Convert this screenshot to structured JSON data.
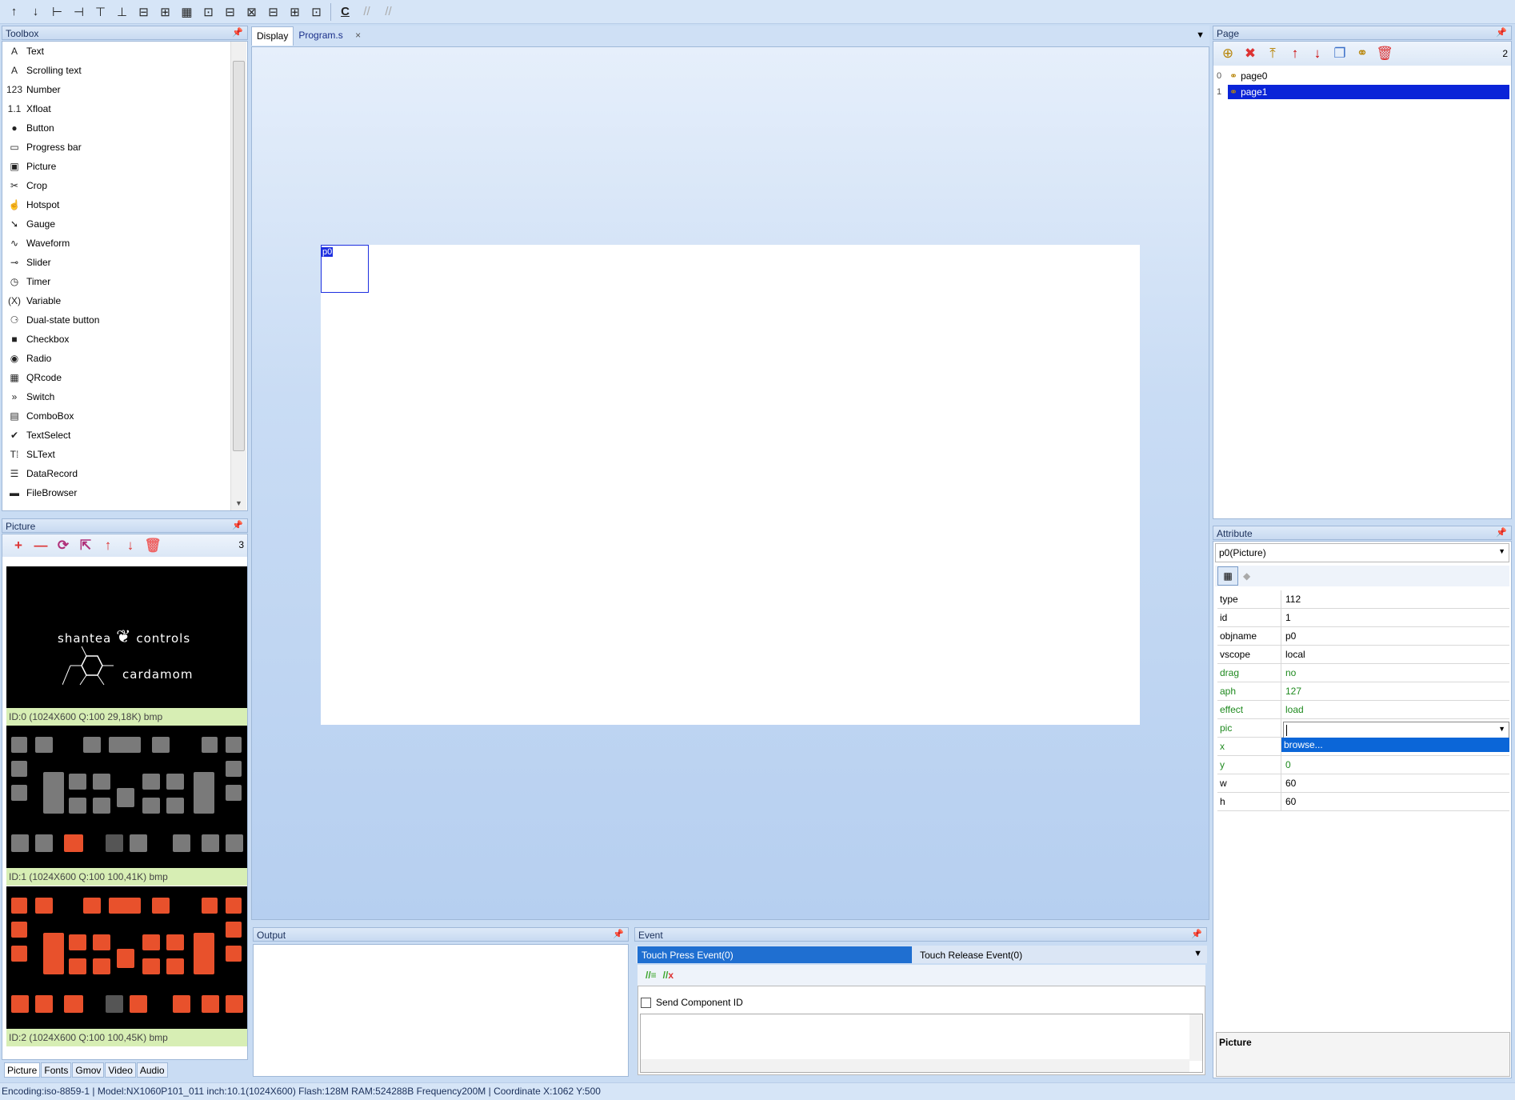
{
  "toolbar": {
    "buttons": [
      "move-up",
      "move-down",
      "align-left",
      "align-right",
      "align-top",
      "align-bottom",
      "center-horizontal",
      "center-vertical",
      "grid",
      "same-width",
      "same-height",
      "distribute-horizontal",
      "equal-size",
      "distribute-vertical",
      "distribute-even"
    ],
    "glyphs": [
      "↑",
      "↓",
      "⊢",
      "⊣",
      "⊤",
      "⊥",
      "⊟",
      "⊞",
      "▦",
      "⊡",
      "⊟",
      "⊠",
      "⊟",
      "⊞",
      "⊡"
    ],
    "comment_glyph": "C",
    "uncomment_glyph": "//"
  },
  "toolbox": {
    "title": "Toolbox",
    "items": [
      {
        "icon": "A",
        "label": "Text"
      },
      {
        "icon": "A",
        "label": "Scrolling text"
      },
      {
        "icon": "123",
        "label": "Number"
      },
      {
        "icon": "1.1",
        "label": "Xfloat"
      },
      {
        "icon": "●",
        "label": "Button"
      },
      {
        "icon": "▭",
        "label": "Progress bar"
      },
      {
        "icon": "▣",
        "label": "Picture"
      },
      {
        "icon": "✂",
        "label": "Crop"
      },
      {
        "icon": "☝",
        "label": "Hotspot"
      },
      {
        "icon": "➘",
        "label": "Gauge"
      },
      {
        "icon": "∿",
        "label": "Waveform"
      },
      {
        "icon": "⊸",
        "label": "Slider"
      },
      {
        "icon": "◷",
        "label": "Timer"
      },
      {
        "icon": "(X)",
        "label": "Variable"
      },
      {
        "icon": "⚆",
        "label": "Dual-state button"
      },
      {
        "icon": "■",
        "label": "Checkbox"
      },
      {
        "icon": "◉",
        "label": "Radio"
      },
      {
        "icon": "▦",
        "label": "QRcode"
      },
      {
        "icon": "»",
        "label": "Switch"
      },
      {
        "icon": "▤",
        "label": "ComboBox"
      },
      {
        "icon": "✔",
        "label": "TextSelect"
      },
      {
        "icon": "T⁞",
        "label": "SLText"
      },
      {
        "icon": "☰",
        "label": "DataRecord"
      },
      {
        "icon": "▬",
        "label": "FileBrowser"
      }
    ]
  },
  "picture_panel": {
    "title": "Picture",
    "count": "3",
    "tool_glyphs": [
      "+",
      "—",
      "⟳",
      "⇱",
      "↑",
      "↓",
      "🗑"
    ],
    "items": [
      {
        "caption": "ID:0  (1024X600 Q:100 29,18K) bmp",
        "brand_left": "shantea",
        "brand_right": "controls",
        "product": "cardamom"
      },
      {
        "caption": "ID:1  (1024X600 Q:100 100,41K) bmp"
      },
      {
        "caption": "ID:2  (1024X600 Q:100 100,45K) bmp"
      }
    ]
  },
  "left_tabs": [
    "Picture",
    "Fonts",
    "Gmov",
    "Video",
    "Audio"
  ],
  "doc_tabs": {
    "display": "Display",
    "program": "Program.s",
    "close": "×"
  },
  "canvas": {
    "component_label": "p0"
  },
  "output": {
    "title": "Output"
  },
  "event": {
    "title": "Event",
    "tab_press": "Touch Press Event(0)",
    "tab_release": "Touch Release Event(0)",
    "send_component_id": "Send Component ID"
  },
  "page_panel": {
    "title": "Page",
    "count": "2",
    "pages": [
      {
        "index": "0",
        "name": "page0"
      },
      {
        "index": "1",
        "name": "page1"
      }
    ],
    "tool_glyphs": [
      "⊕",
      "✖",
      "⤒",
      "↑",
      "↓",
      "❐",
      "⚭",
      "🗑"
    ]
  },
  "attribute_panel": {
    "title": "Attribute",
    "selected_object": "p0(Picture)",
    "rows": [
      {
        "key": "type",
        "value": "112",
        "green": false
      },
      {
        "key": "id",
        "value": "1",
        "green": false
      },
      {
        "key": "objname",
        "value": "p0",
        "green": false
      },
      {
        "key": "vscope",
        "value": "local",
        "green": false
      },
      {
        "key": "drag",
        "value": "no",
        "green": true
      },
      {
        "key": "aph",
        "value": "127",
        "green": true
      },
      {
        "key": "effect",
        "value": "load",
        "green": true
      },
      {
        "key": "pic",
        "value": "",
        "green": true
      },
      {
        "key": "x",
        "value": "",
        "green": true
      },
      {
        "key": "y",
        "value": "0",
        "green": true
      },
      {
        "key": "w",
        "value": "60",
        "green": false
      },
      {
        "key": "h",
        "value": "60",
        "green": false
      }
    ],
    "dropdown_option": "browse...",
    "description_title": "Picture"
  },
  "status_bar": {
    "text": "Encoding:iso-8859-1 | Model:NX1060P101_011 inch:10.1(1024X600) Flash:128M RAM:524288B Frequency200M |    Coordinate X:1062  Y:500"
  },
  "colors": {
    "accent": "#0a24d8",
    "tab_blue": "#1f6fd1",
    "key_gray": "#7a7a7a",
    "key_orange": "#e8512c"
  }
}
